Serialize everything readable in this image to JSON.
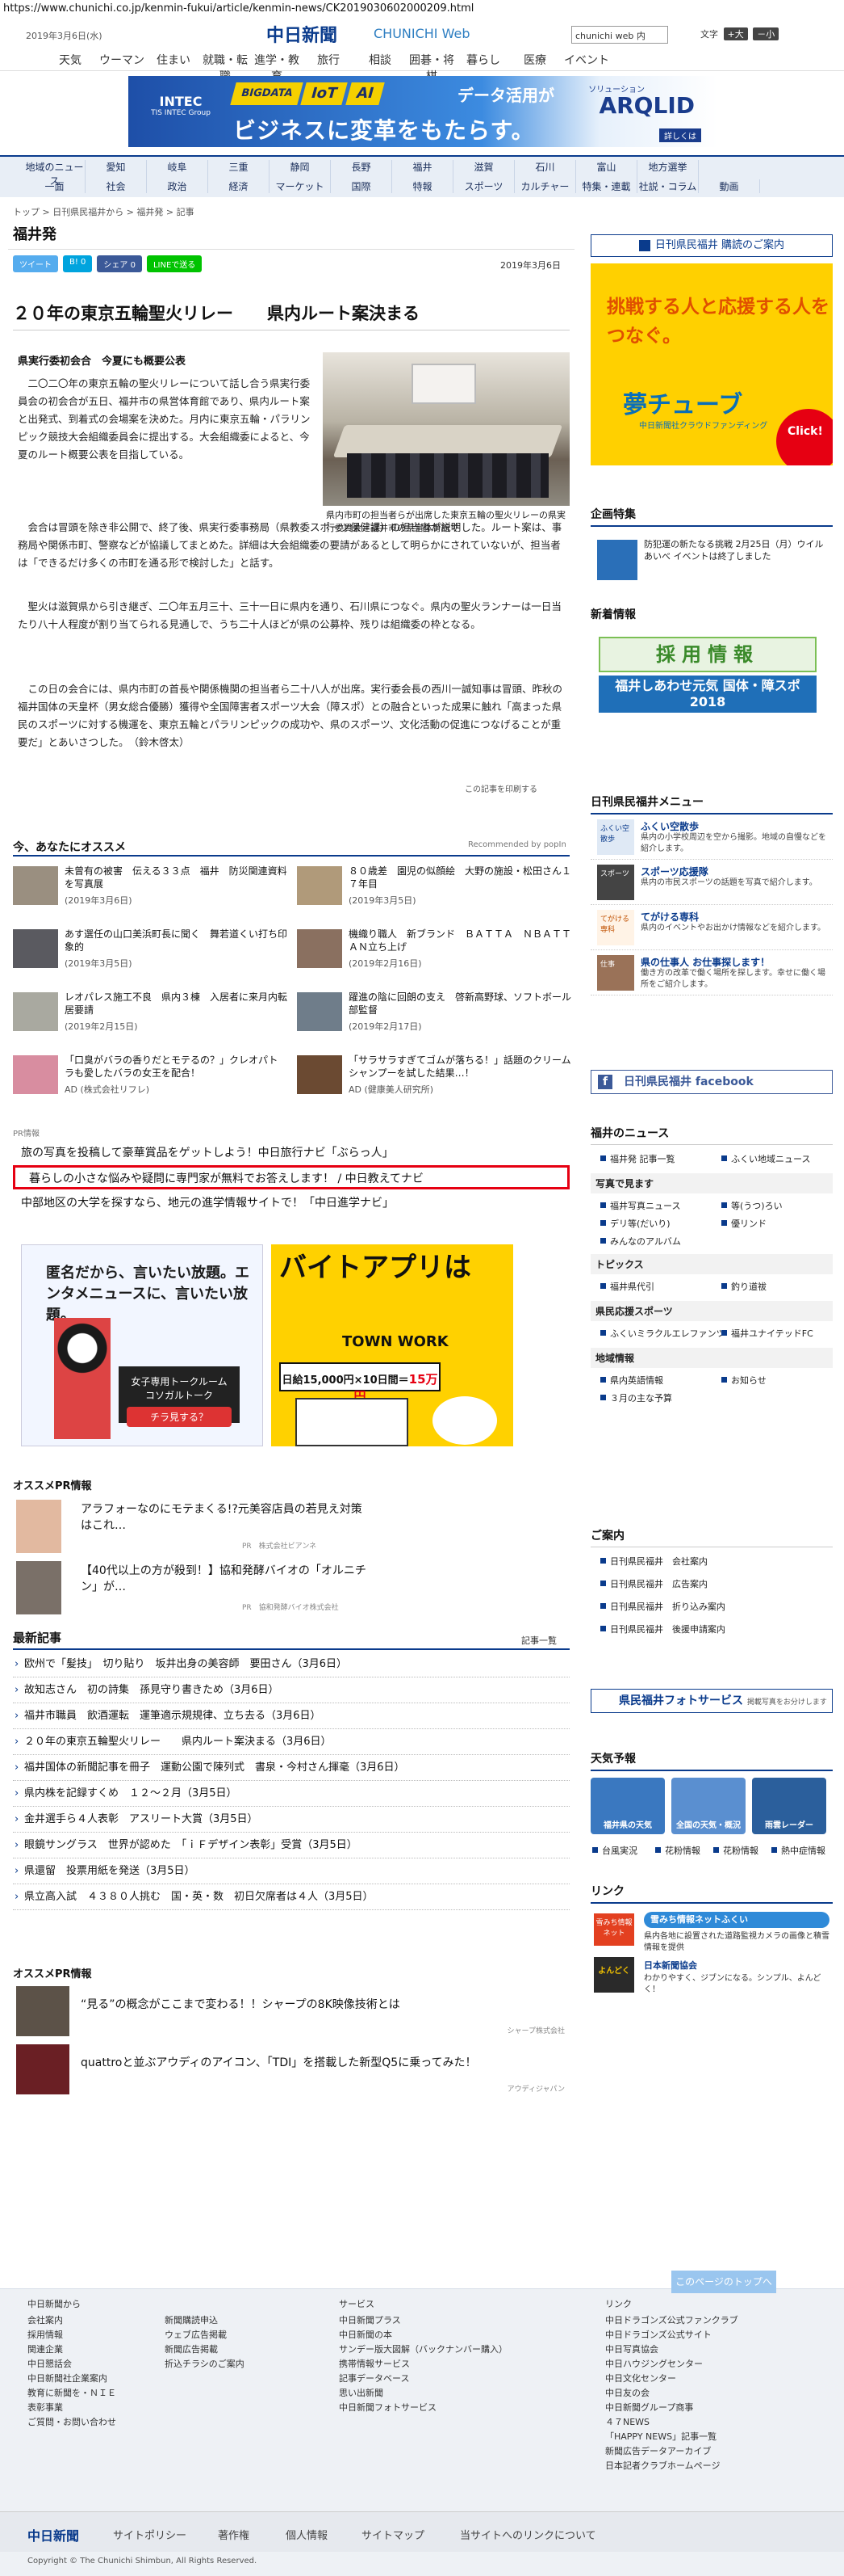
{
  "url": "https://www.chunichi.co.jp/kenmin-fukui/article/kenmin-news/CK2019030602000209.html",
  "header": {
    "date": "2019年3月6日(水)",
    "logo": "中日新聞",
    "logo_sub": "CHUNICHI Web",
    "search_placeholder": "chunichi web 内",
    "font_label": "文字",
    "font_large": "+大",
    "font_small": "－小"
  },
  "gnav": [
    "天気",
    "ウーマン",
    "住まい",
    "就職・転職",
    "進学・教育",
    "旅行",
    "相談",
    "囲碁・将棋",
    "暮らし",
    "医療",
    "イベント"
  ],
  "banner": {
    "left": "INTEC",
    "left_sub": "TIS INTEC Group",
    "tags": [
      "BIGDATA",
      "IoT",
      "AI"
    ],
    "tagline": "データ活用が",
    "main": "ビジネスに変革をもたらす。",
    "brand_small": "ソリューション",
    "brand": "ARQLID",
    "more": "詳しくは"
  },
  "category_nav": {
    "row1": [
      "地域のニュース",
      "愛知",
      "岐阜",
      "三重",
      "静岡",
      "長野",
      "福井",
      "滋賀",
      "石川",
      "富山",
      "地方選挙"
    ],
    "row2": [
      "一面",
      "社会",
      "政治",
      "経済",
      "マーケット",
      "国際",
      "特報",
      "スポーツ",
      "カルチャー",
      "特集・連載",
      "社説・コラム",
      "動画"
    ]
  },
  "breadcrumb": "トップ > 日刊県民福井から > 福井発 > 記事",
  "section_title": "福井発",
  "share": {
    "tweet": "ツイート",
    "hatena": "B! 0",
    "facebook": "シェア 0",
    "line": "LINEで送る"
  },
  "article": {
    "date": "2019年3月6日",
    "headline": "２０年の東京五輪聖火リレー　　県内ルート案決まる",
    "subhead": "県実行委初会合　今夏にも概要公表",
    "photo_caption": "県内市町の担当者らが出席した東京五輪の聖火リレーの県実行委員会＝福井市の県営体育館で",
    "p1": "二〇二〇年の東京五輪の聖火リレーについて話し合う県実行委員会の初会合が五日、福井市の県営体育館であり、県内ルート案と出発式、到着式の会場案を決めた。月内に東京五輪・パラリンピック競技大会組織委員会に提出する。大会組織委によると、今夏のルート概要公表を目指している。",
    "p2": "会合は冒頭を除き非公開で、終了後、県実行委事務局（県教委スポーツ保健課）の担当者が説明した。ルート案は、事務局や関係市町、警察などが協議してまとめた。詳細は大会組織委の要請があるとして明らかにされていないが、担当者は「できるだけ多くの市町を通る形で検討した」と話す。",
    "p3": "聖火は滋賀県から引き継ぎ、二〇年五月三十、三十一日に県内を通り、石川県につなぐ。県内の聖火ランナーは一日当たり八十人程度が割り当てられる見通しで、うち二十人ほどが県の公募枠、残りは組織委の枠となる。",
    "p4": "この日の会合には、県内市町の首長や関係機関の担当者ら二十八人が出席。実行委会長の西川一誠知事は冒頭、昨秋の福井国体の天皇杯（男女総合優勝）獲得や全国障害者スポーツ大会（障スポ）との融合といった成果に触れ「高まった県民のスポーツに対する機運を、東京五輪とパラリンピックの成功や、県のスポーツ、文化活動の促進につなげることが重要だ」とあいさつした。　（鈴木啓太）",
    "print": "この記事を印刷する"
  },
  "recommend": {
    "title": "今、あなたにオススメ",
    "by": "Recommended by popIn",
    "items": [
      {
        "title": "未曾有の被害　伝える３３点　福井　防災関連資料を写真展",
        "date": "(2019年3月6日)"
      },
      {
        "title": "８０歳差　園児の似顔絵　大野の施設・松田さん１７年目",
        "date": "(2019年3月5日)"
      },
      {
        "title": "あす選任の山口美浜町長に聞く　舞若道くい打ち印象的",
        "date": "(2019年3月5日)"
      },
      {
        "title": "機織り職人　新ブランド　ＢＡＴＴＡ　ＮＢＡＴＴＡＮ立ち上げ",
        "date": "(2019年2月16日)"
      },
      {
        "title": "レオパレス施工不良　県内３棟　入居者に来月内転居要請",
        "date": "(2019年2月15日)"
      },
      {
        "title": "躍進の陰に回朗の支え　啓新高野球、ソフトボール部監督",
        "date": "(2019年2月17日)"
      },
      {
        "title": "「口臭がバラの香りだとモテるの？」クレオパトラも愛したバラの女王を配合！",
        "date": "AD (株式会社リフレ)"
      },
      {
        "title": "「サラサラすぎてゴムが落ちる！」話題のクリームシャンプーを試した結果…！",
        "date": "AD (健康美人研究所)"
      }
    ]
  },
  "pr": {
    "label": "PR情報",
    "lines": [
      "旅の写真を投稿して豪華賞品をゲットしよう！中日旅行ナビ「ぶらっ人」",
      "暮らしの小さな悩みや疑問に専門家が無料でお答えします！ / 中日教えてナビ",
      "中部地区の大学を探すなら、地元の進学情報サイトで！「中日進学ナビ」"
    ]
  },
  "ads": {
    "ad1_title": "匿名だから、言いたい放題。エンタメニュースに、言いたい放題。",
    "ad1_brand": "女子専用トークルーム コソガルトーク",
    "ad1_cta": "チラ見する？",
    "ad2_title": "バイトアプリは",
    "ad2_brand": "TOWN WORK",
    "ad2_pay": "日給15,000円×10日間＝",
    "ad2_pay_total": "15万円"
  },
  "osusume_pr": {
    "title": "オススメPR情報",
    "items": [
      {
        "title": "アラフォーなのにモテまくる!?元美容店員の若見え対策はこれ…",
        "sponsor": "PR　株式会社ビアンネ"
      },
      {
        "title": "【40代以上の方が殺到！】協和発酵バイオの「オルニチン」が…",
        "sponsor": "PR　協和発酵バイオ株式会社"
      }
    ]
  },
  "latest": {
    "title": "最新記事",
    "more": "記事一覧",
    "items": [
      "欧州で「髪技」　切り貼り　坂井出身の美容師　要田さん（3月6日）",
      "故知志さん　初の詩集　孫見守り書きため（3月6日）",
      "福井市職員　飲酒運転　運筆適示規規律、立ち去る（3月6日）",
      "２０年の東京五輪聖火リレー　　県内ルート案決まる（3月6日）",
      "福井国体の新聞記事を冊子　運動公園で陳列式　書泉・今村さん揮毫（3月6日）",
      "県内株を記録すくめ　１２～２月（3月5日）",
      "金井選手ら４人表彰　アスリート大賞（3月5日）",
      "眼鏡サングラス　世界が認めた　「ｉＦデザイン表彰」受賞（3月5日）",
      "県還留　投票用紙を発送（3月5日）",
      "県立高入試　４３８０人挑む　国・英・数　初日欠席者は４人（3月5日）"
    ]
  },
  "osusume_pr2": {
    "title": "オススメPR情報",
    "items": [
      {
        "title": "“見る”の概念がここまで変わる！！シャープの8K映像技術とは",
        "sponsor": "シャープ株式会社"
      },
      {
        "title": "quattroと並ぶアウディのアイコン、「TDI」を搭載した新型Q5に乗ってみた！",
        "sponsor": "アウディジャパン"
      }
    ]
  },
  "sidebar": {
    "subscribe": "日刊県民福井 購読のご案内",
    "ad_title": "挑戦する人と応援する人をつなぐ。",
    "ad_brand": "夢チューブ",
    "ad_sub": "中日新聞社クラウドファンディング",
    "ad_click": "Click!",
    "kikaku_title": "企画特集",
    "kikaku_text": "防犯運の新たなる挑戦 2月25日（月）ウイルあいべ イベントは終了しました",
    "shinchaku_title": "新着情報",
    "recruit": "採用情報",
    "kokutai": "福井しあわせ元気 国体・障スポ 2018",
    "menu_title": "日刊県民福井メニュー",
    "menu": [
      {
        "title": "ふくい空散歩",
        "desc": "県内の小学校周辺を空から撮影。地域の自慢などを紹介します。",
        "icon": "ふくい空散歩"
      },
      {
        "title": "スポーツ応援隊",
        "desc": "県内の市民スポーツの話題を写真で紹介します。",
        "icon": "スポーツ"
      },
      {
        "title": "てがける専科",
        "desc": "県内のイベントやお出かけ情報などを紹介します。",
        "icon": "てがける専科"
      },
      {
        "title": "県の仕事人 お仕事探します！",
        "desc": "働き方の改革で働く場所を探します。幸せに働く場所をご紹介します。",
        "icon": "仕事"
      }
    ],
    "facebook": "日刊県民福井 facebook",
    "news_title": "福井のニュース",
    "news": [
      {
        "group": "",
        "items": [
          "福井発 記事一覧",
          "ふくい地域ニュース"
        ]
      },
      {
        "group": "写真で見ます",
        "items": [
          "福井写真ニュース",
          "等(うつ)ろい",
          "デリ等(だいり)",
          "優リンド",
          "みんなのアルバム"
        ]
      },
      {
        "group": "トピックス",
        "items": [
          "福井県代引",
          "釣り道祓"
        ]
      },
      {
        "group": "県民応援スポーツ",
        "items": [
          "ふくいミラクルエレファンツ",
          "福井ユナイテッドFC"
        ]
      },
      {
        "group": "地域情報",
        "items": [
          "県内英語情報",
          "お知らせ",
          "３月の主な予算"
        ]
      }
    ],
    "guide_title": "ご案内",
    "guide": [
      "日刊県民福井　会社案内",
      "日刊県民福井　広告案内",
      "日刊県民福井　折り込み案内",
      "日刊県民福井　後援申請案内"
    ],
    "photo_service": "県民福井フォトサービス",
    "photo_service_sub": "掲載写真をお分けします",
    "weather_title": "天気予報",
    "weather": [
      "福井県の天気",
      "全国の天気・概況",
      "雨雲レーダー"
    ],
    "weather_links": [
      "台風実況",
      "花粉情報",
      "花粉情報",
      "熱中症情報"
    ],
    "link_title": "リンク",
    "link1_head": "雪みち情報ネットふくい",
    "link1_text": "県内各地に設置された道路監視カメラの画像と積雪情報を提供",
    "link1_icon": "雪みち情報ネット",
    "link2_head": "日本新聞協会",
    "link2_text": "わかりやすく、ジブンになる。シンプル、よんどく！",
    "link2_icon": "よんどく"
  },
  "totop": "このページのトップへ",
  "footer": {
    "col1": {
      "head": "中日新聞から",
      "items": [
        "会社案内",
        "採用情報",
        "関連企業",
        "中日懇話会",
        "中日新聞社企業案内",
        "教育に新聞を・ＮＩＥ",
        "表彰事業",
        "ご質問・お問い合わせ"
      ]
    },
    "col2": {
      "head": "",
      "items": [
        "新聞購読申込",
        "ウェブ広告掲載",
        "新聞広告掲載",
        "折込チラシのご案内"
      ]
    },
    "col3": {
      "head": "サービス",
      "items": [
        "中日新聞プラス",
        "中日新聞の本",
        "サンデー版大図解（バックナンバー購入）",
        "携帯情報サービス",
        "記事データベース",
        "思い出新聞",
        "中日新聞フォトサービス"
      ]
    },
    "col4": {
      "head": "リンク",
      "items": [
        "中日ドラゴンズ公式ファンクラブ",
        "中日ドラゴンズ公式サイト",
        "中日写真協会",
        "中日ハウジングセンター",
        "中日文化センター",
        "中日友の会",
        "中日新聞グループ商事",
        "４７NEWS",
        "「HAPPY NEWS」記事一覧",
        "新聞広告データアーカイブ",
        "日本記者クラブホームページ"
      ]
    },
    "nav": [
      "サイトポリシー",
      "著作権",
      "個人情報",
      "サイトマップ",
      "当サイトへのリンクについて"
    ],
    "logo": "中日新聞",
    "copyright": "Copyright © The Chunichi Shimbun, All Rights Reserved."
  }
}
